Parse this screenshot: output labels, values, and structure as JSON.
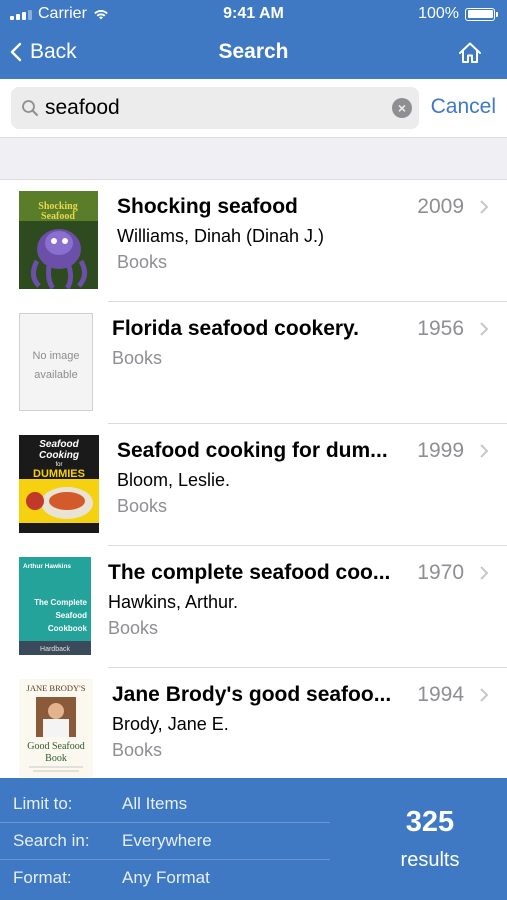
{
  "status_bar": {
    "carrier": "Carrier",
    "time": "9:41 AM",
    "battery": "100%"
  },
  "nav": {
    "back_label": "Back",
    "title": "Search"
  },
  "search": {
    "query": "seafood",
    "cancel_label": "Cancel"
  },
  "results": [
    {
      "title": "Shocking seafood",
      "author": "Williams, Dinah (Dinah J.)",
      "format": "Books",
      "year": "2009"
    },
    {
      "title": "Florida seafood cookery.",
      "author": "",
      "format": "Books",
      "year": "1956",
      "cover_text": [
        "No image",
        "available"
      ]
    },
    {
      "title": "Seafood cooking for dum...",
      "author": "Bloom, Leslie.",
      "format": "Books",
      "year": "1999",
      "cover_text": [
        "Seafood",
        "Cooking",
        "for",
        "DUMMIES"
      ]
    },
    {
      "title": "The complete seafood coo...",
      "author": "Hawkins, Arthur.",
      "format": "Books",
      "year": "1970",
      "cover_text": [
        "Arthur Hawkins",
        "The Complete",
        "Seafood",
        "Cookbook",
        "Hardback"
      ]
    },
    {
      "title": "Jane Brody's good seafoo...",
      "author": "Brody, Jane E.",
      "format": "Books",
      "year": "1994",
      "cover_text": [
        "JANE BRODY'S",
        "Good Seafood",
        "Book"
      ]
    }
  ],
  "filters": [
    {
      "label": "Limit to:",
      "value": "All Items"
    },
    {
      "label": "Search in:",
      "value": "Everywhere"
    },
    {
      "label": "Format:",
      "value": "Any Format"
    }
  ],
  "summary": {
    "count": "325",
    "label": "results"
  },
  "colors": {
    "brand": "#3f79c4",
    "secondary_text": "#8e8e93",
    "separator": "#dcdcdc"
  }
}
